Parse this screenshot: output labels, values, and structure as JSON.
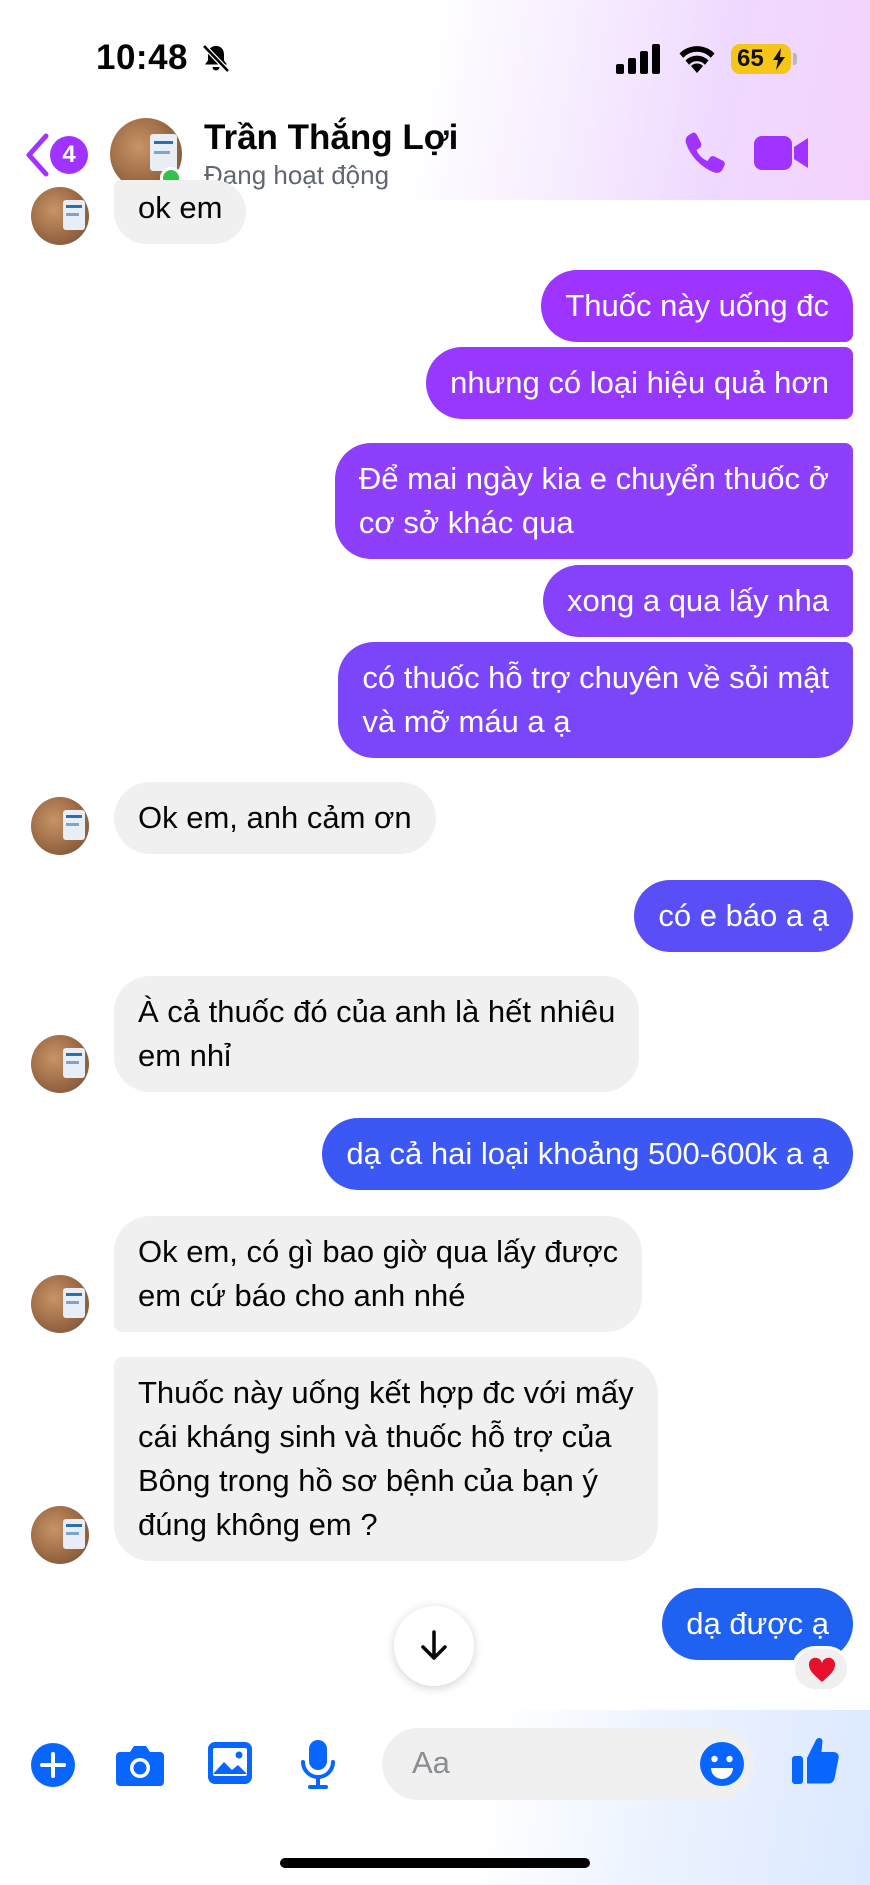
{
  "status_bar": {
    "time": "10:48",
    "battery": "65"
  },
  "header": {
    "unread_count": "4",
    "contact_name": "Trần Thắng Lợi",
    "status": "Đang hoạt động"
  },
  "messages": [
    {
      "dir": "in",
      "text": "ok em",
      "avatar": true
    },
    {
      "dir": "out",
      "text": "Thuốc này uống đc"
    },
    {
      "dir": "out",
      "text": "nhưng có loại hiệu quả hơn"
    },
    {
      "dir": "out",
      "text": "Để mai ngày kia e chuyển thuốc ở\ncơ sở khác qua"
    },
    {
      "dir": "out",
      "text": "xong a qua lấy nha"
    },
    {
      "dir": "out",
      "text": "có thuốc hỗ trợ chuyên về sỏi mật\nvà mỡ máu a ạ"
    },
    {
      "dir": "in",
      "text": "Ok em, anh cảm ơn",
      "avatar": true
    },
    {
      "dir": "out",
      "text": "có e báo a ạ"
    },
    {
      "dir": "in",
      "text": "À cả thuốc đó của anh là hết nhiêu\nem nhỉ",
      "avatar": true
    },
    {
      "dir": "out",
      "text": "dạ cả hai loại khoảng 500-600k a ạ"
    },
    {
      "dir": "in",
      "text": "Ok em, có gì bao giờ qua lấy được\nem cứ báo cho anh nhé",
      "avatar": true
    },
    {
      "dir": "in",
      "text": "Thuốc này uống kết hợp đc với mấy\ncái kháng sinh và thuốc hỗ trợ của\nBông trong hồ sơ bệnh của bạn ý\nđúng không em ?",
      "avatar": true
    },
    {
      "dir": "out",
      "text": "dạ được ạ",
      "reaction": "heart-icon"
    }
  ],
  "composer": {
    "placeholder": "Aa"
  },
  "colors": {
    "accent": "#a033ff",
    "bubble_in": "#f0f0f0",
    "gradient_top": "#a033ff",
    "gradient_bottom": "#1c6bff",
    "online": "#31c24d"
  }
}
